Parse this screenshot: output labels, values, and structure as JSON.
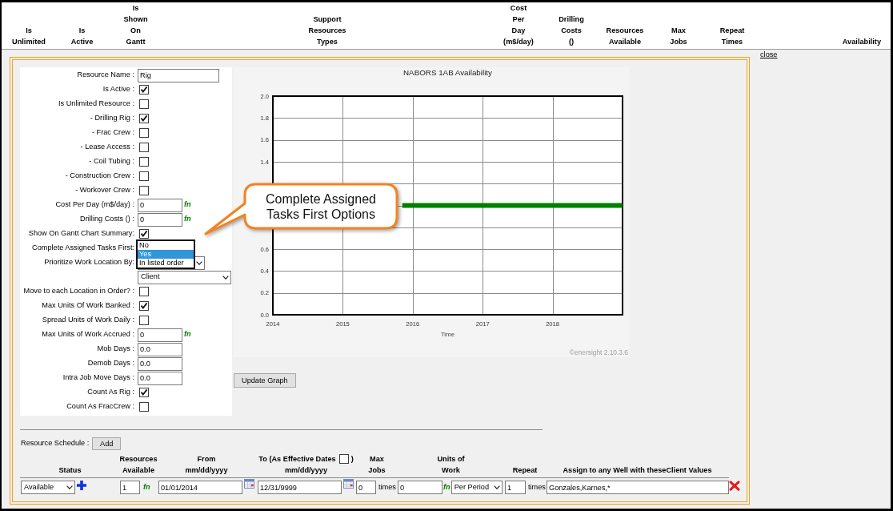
{
  "header": {
    "columns": [
      "Is Unlimited",
      "Is Active",
      "Is Shown On Gantt",
      "Support Resources Types",
      "Cost Per Day (m$/day)",
      "Drilling Costs ()",
      "Resources Available",
      "Max Jobs",
      "Repeat Times",
      "Availability"
    ]
  },
  "close_link": "close",
  "resource_form": {
    "rows": [
      {
        "label": "Resource Name :",
        "kind": "text",
        "value": "Rig"
      },
      {
        "label": "Is Active :",
        "kind": "checkbox",
        "checked": true
      },
      {
        "label": "Is Unlimited Resource :",
        "kind": "checkbox",
        "checked": false
      },
      {
        "label": "- Drilling Rig :",
        "kind": "checkbox",
        "checked": true
      },
      {
        "label": "- Frac Crew :",
        "kind": "checkbox",
        "checked": false
      },
      {
        "label": "- Lease Access :",
        "kind": "checkbox",
        "checked": false
      },
      {
        "label": "- Coil Tubing :",
        "kind": "checkbox",
        "checked": false
      },
      {
        "label": "- Construction Crew :",
        "kind": "checkbox",
        "checked": false
      },
      {
        "label": "- Workover Crew :",
        "kind": "checkbox",
        "checked": false
      },
      {
        "label": "Cost Per Day (m$/day) :",
        "kind": "text",
        "value": "0",
        "suffix": "fn"
      },
      {
        "label": "Drilling Costs () :",
        "kind": "text",
        "value": "0",
        "suffix": "fn"
      },
      {
        "label": "Show On Gantt Chart Summary:",
        "kind": "checkbox",
        "checked": true
      },
      {
        "label": "Complete Assigned Tasks First:",
        "kind": "open_list",
        "options": [
          {
            "label": "No",
            "selected": false
          },
          {
            "label": "Yes",
            "selected": true
          },
          {
            "label": "In listed order",
            "selected": false
          }
        ]
      },
      {
        "label": "Prioritize Work Location By:",
        "kind": "select"
      },
      {
        "kind": "select",
        "value": "Client"
      },
      {
        "label": "Move to each Location in Order? :",
        "kind": "checkbox",
        "checked": false
      },
      {
        "label": "Max Units Of Work Banked :",
        "kind": "checkbox",
        "checked": true
      },
      {
        "label": "Spread Units of Work Daily :",
        "kind": "checkbox",
        "checked": false
      },
      {
        "label": "Max Units of Work Accrued :",
        "kind": "text",
        "value": "0",
        "suffix": "fn"
      },
      {
        "label": "Mob Days :",
        "kind": "text",
        "value": "0.0"
      },
      {
        "label": "Demob Days :",
        "kind": "text",
        "value": "0.0"
      },
      {
        "label": "Intra Job Move Days :",
        "kind": "text",
        "value": "0.0"
      },
      {
        "label": "Count As Rig :",
        "kind": "checkbox",
        "checked": true
      },
      {
        "label": "Count As FracCrew :",
        "kind": "checkbox",
        "checked": false
      }
    ]
  },
  "graph": {
    "chart_data": {
      "type": "line",
      "title": "NABORS 1AB Availability",
      "xlabel": "Time",
      "x": [
        2015.85,
        2019
      ],
      "series": [
        {
          "color": "#008000",
          "values": [
            1,
            1
          ]
        }
      ],
      "xlim": [
        2014,
        2019
      ],
      "ylim": [
        0,
        2
      ],
      "xticks": [
        2014,
        2015,
        2016,
        2017,
        2018
      ],
      "yticks": [
        {
          "value": 0,
          "label": "0.0"
        },
        0.2,
        0.4,
        0.6,
        1.4,
        1.6,
        1.8,
        {
          "value": 2,
          "label": "2.0"
        }
      ],
      "grid": true
    },
    "credit": "©enersight 2.10.3.6",
    "update_button": "Update Graph"
  },
  "callout": {
    "text": "Complete Assigned Tasks First Options"
  },
  "resource_schedule": {
    "label": "Resource Schedule :",
    "add_button": "Add",
    "columns": [
      {
        "kind": "text",
        "lines": [
          "Status"
        ]
      },
      {
        "kind": "text",
        "lines": [
          "Resources",
          "Available"
        ]
      },
      {
        "kind": "text",
        "lines": [
          "From",
          "mm/dd/yyyy"
        ]
      },
      {
        "kind": "checkbox",
        "before": "To (As Effective Dates",
        "checked": false,
        "after": ")",
        "below": "mm/dd/yyyy"
      },
      {
        "kind": "text",
        "lines": [
          "Max",
          "Jobs"
        ]
      },
      {
        "kind": "text",
        "lines": [
          "Units of",
          "Work"
        ]
      },
      {
        "kind": "text",
        "lines": [
          "Repeat"
        ]
      },
      {
        "kind": "text",
        "lines": [
          "Assign to any Well with theseClient Values"
        ]
      }
    ],
    "rows": [
      {
        "status": "Available",
        "resources_available": "1",
        "resources_suffix": "fn",
        "from": "01/01/2014",
        "to": "12/31/9999",
        "max_jobs": "0",
        "max_jobs_unit": "times",
        "units_of_work": "0",
        "units_suffix": "fn",
        "units_period": "Per Period",
        "repeat": "1",
        "repeat_unit": "times",
        "assign_values": "Gonzales,Karnes,*"
      }
    ]
  }
}
